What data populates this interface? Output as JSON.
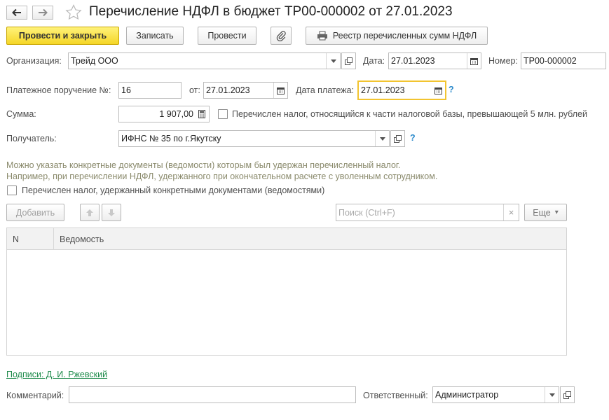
{
  "window": {
    "title": "Перечисление НДФЛ в бюджет ТР00-000002 от 27.01.2023"
  },
  "toolbar": {
    "post_and_close": "Провести и закрыть",
    "save": "Записать",
    "post": "Провести",
    "registry": "Реестр перечисленных сумм НДФЛ"
  },
  "form": {
    "organization_label": "Организация:",
    "organization_value": "Трейд ООО",
    "date_label": "Дата:",
    "date_value": "27.01.2023",
    "number_label": "Номер:",
    "number_value": "ТР00-000002",
    "payment_order_label": "Платежное поручение №:",
    "payment_order_value": "16",
    "from_label": "от:",
    "from_value": "27.01.2023",
    "payment_date_label": "Дата платежа:",
    "payment_date_value": "27.01.2023",
    "sum_label": "Сумма:",
    "sum_value": "1 907,00",
    "over5m_label": "Перечислен налог, относящийся к части налоговой базы, превышающей 5 млн. рублей",
    "over5m_checked": false,
    "recipient_label": "Получатель:",
    "recipient_value": "ИФНС № 35 по г.Якутску",
    "help_glyph": "?"
  },
  "hint": {
    "line1": "Можно указать конкретные документы (ведомости) которым был удержан перечисленный налог.",
    "line2": "Например, при перечислении НДФЛ, удержанного при окончательном расчете с уволенным сотрудником."
  },
  "specific_docs": {
    "label": "Перечислен налог, удержанный конкретными документами (ведомостями)",
    "checked": false
  },
  "table_toolbar": {
    "add": "Добавить",
    "search_placeholder": "Поиск (Ctrl+F)",
    "clear_glyph": "×",
    "more": "Еще",
    "more_arrow": "▾"
  },
  "table": {
    "columns": [
      "N",
      "Ведомость"
    ],
    "rows": []
  },
  "footer": {
    "signatures": "Подписи: Д. И. Ржевский",
    "comment_label": "Комментарий:",
    "comment_value": "",
    "responsible_label": "Ответственный:",
    "responsible_value": "Администратор"
  },
  "colors": {
    "primary_button": "#f5d627",
    "focus_border": "#f2c430",
    "link": "#1d8a4a",
    "help": "#2b8acb",
    "hint_text": "#8a8a6c"
  }
}
